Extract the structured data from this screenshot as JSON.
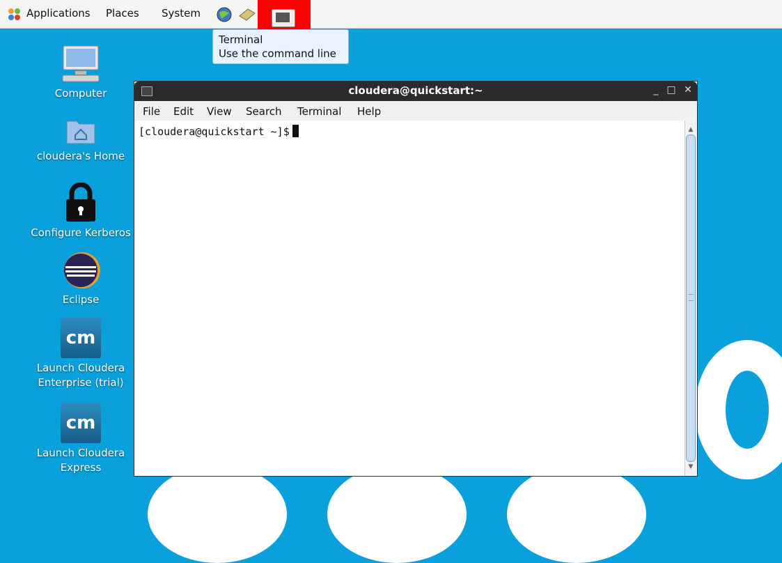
{
  "panel": {
    "applications": "Applications",
    "places": "Places",
    "system": "System"
  },
  "tooltip": {
    "title": "Terminal",
    "description": "Use the command line"
  },
  "desktop": {
    "icons": [
      {
        "label": "Computer"
      },
      {
        "label": "cloudera's Home"
      },
      {
        "label": "Configure Kerberos"
      },
      {
        "label": "Eclipse"
      },
      {
        "label": "Launch Cloudera Enterprise (trial)",
        "badge": "cm"
      },
      {
        "label": "Launch Cloudera Express",
        "badge": "cm"
      }
    ]
  },
  "terminal": {
    "title": "cloudera@quickstart:~",
    "menu": [
      "File",
      "Edit",
      "View",
      "Search",
      "Terminal",
      "Help"
    ],
    "prompt": "[cloudera@quickstart ~]$"
  },
  "colors": {
    "desktop_bg": "#0aa0dc",
    "highlight": "#ff0000"
  }
}
